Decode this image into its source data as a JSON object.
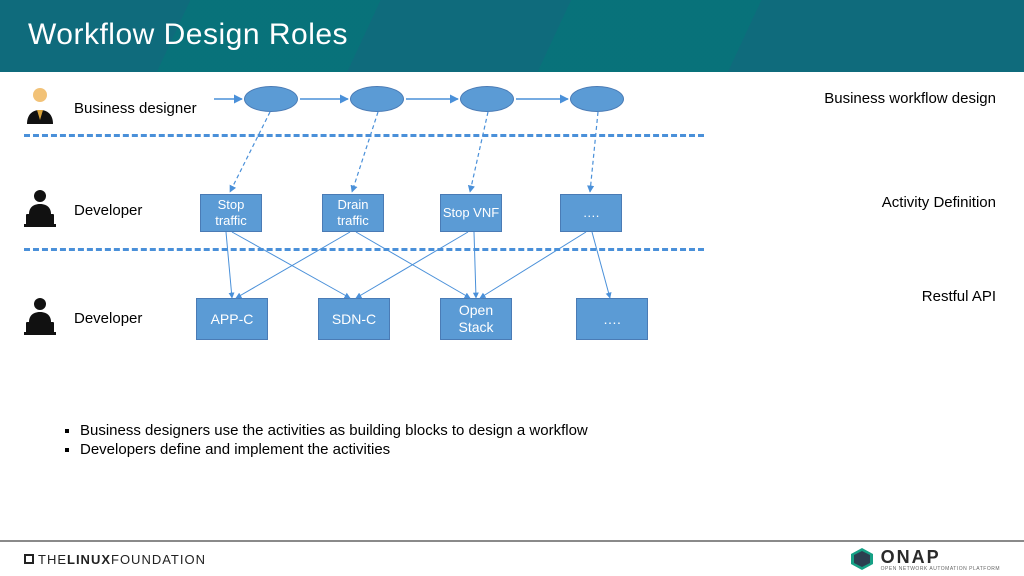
{
  "header": {
    "title": "Workflow Design Roles"
  },
  "tiers": {
    "business": {
      "role": "Business designer",
      "label": "Business workflow design"
    },
    "activity": {
      "role": "Developer",
      "label": "Activity Definition"
    },
    "api": {
      "role": "Developer",
      "label": "Restful API"
    }
  },
  "activities": [
    "Stop traffic",
    "Drain traffic",
    "Stop VNF",
    "…."
  ],
  "apis": [
    "APP-C",
    "SDN-C",
    "Open Stack",
    "…."
  ],
  "notes": [
    "Business designers use the activities as building blocks to design a workflow",
    "Developers define and implement the activities"
  ],
  "footer": {
    "linux_foundation": "THE LINUX FOUNDATION",
    "onap": "ONAP",
    "onap_sub": "OPEN NETWORK AUTOMATION PLATFORM"
  }
}
